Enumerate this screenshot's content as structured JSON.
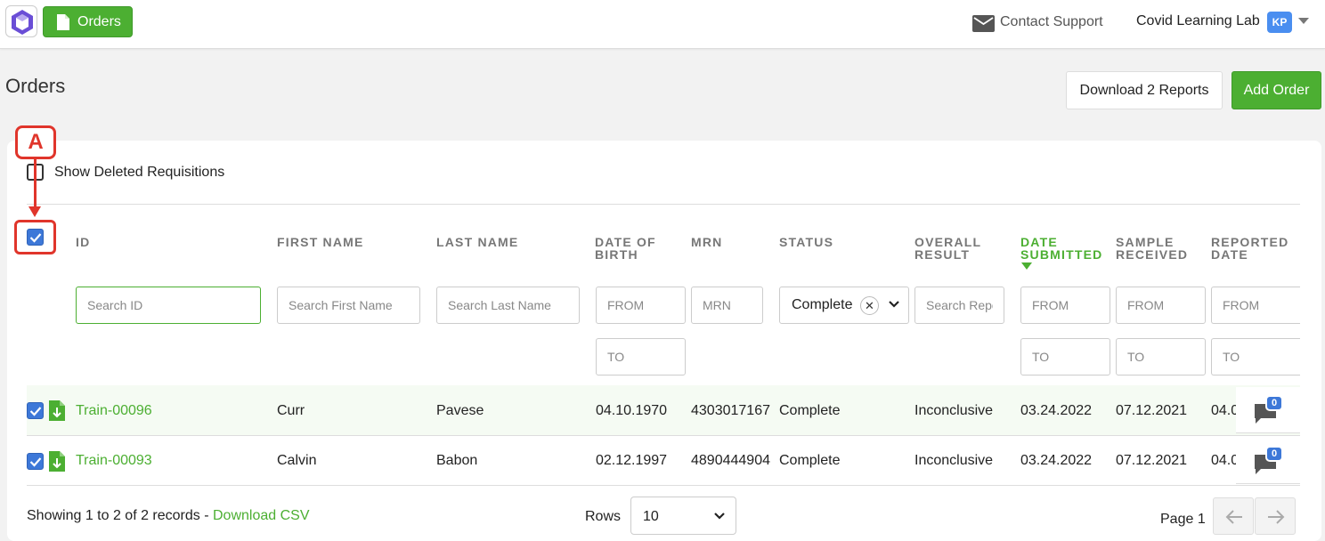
{
  "topbar": {
    "orders_label": "Orders",
    "contact_label": "Contact Support",
    "account_name": "Covid Learning Lab",
    "avatar_initials": "KP"
  },
  "page": {
    "title": "Orders",
    "download_label": "Download 2 Reports",
    "add_label": "Add Order"
  },
  "annotation_marker": "A",
  "filters": {
    "show_deleted_label": "Show Deleted Requisitions",
    "id_placeholder": "Search ID",
    "first_placeholder": "Search First Name",
    "last_placeholder": "Search Last Name",
    "dob_from": "FROM",
    "dob_to": "TO",
    "mrn_placeholder": "MRN",
    "status_value": "Complete",
    "result_placeholder": "Search Reports",
    "submitted_from": "FROM",
    "submitted_to": "TO",
    "received_from": "FROM",
    "received_to": "TO",
    "reported_from": "FROM",
    "reported_to": "TO"
  },
  "columns": {
    "id": "ID",
    "first": "FIRST NAME",
    "last": "LAST NAME",
    "dob_1": "DATE OF",
    "dob_2": "BIRTH",
    "mrn": "MRN",
    "status": "STATUS",
    "result_1": "OVERALL",
    "result_2": "RESULT",
    "submitted_1": "DATE",
    "submitted_2": "SUBMITTED",
    "received_1": "SAMPLE",
    "received_2": "RECEIVED",
    "reported_1": "REPORTED",
    "reported_2": "DATE"
  },
  "rows": [
    {
      "id": "Train-00096",
      "first": "Curr",
      "last": "Pavese",
      "dob": "04.10.1970",
      "mrn": "4303017167",
      "status": "Complete",
      "result": "Inconclusive",
      "submitted": "03.24.2022",
      "received": "07.12.2021",
      "reported": "04.0",
      "comments": "0"
    },
    {
      "id": "Train-00093",
      "first": "Calvin",
      "last": "Babon",
      "dob": "02.12.1997",
      "mrn": "4890444904",
      "status": "Complete",
      "result": "Inconclusive",
      "submitted": "03.24.2022",
      "received": "07.12.2021",
      "reported": "04.0",
      "comments": "0"
    }
  ],
  "footer": {
    "showing_text": "Showing 1 to 2 of 2 records - ",
    "download_csv": "Download CSV",
    "rows_label": "Rows",
    "rows_value": "10",
    "page_label": "Page 1"
  },
  "colors": {
    "brand_green": "#4caf32",
    "checkbox_blue": "#3d78d8",
    "annotation_red": "#e0352b"
  }
}
